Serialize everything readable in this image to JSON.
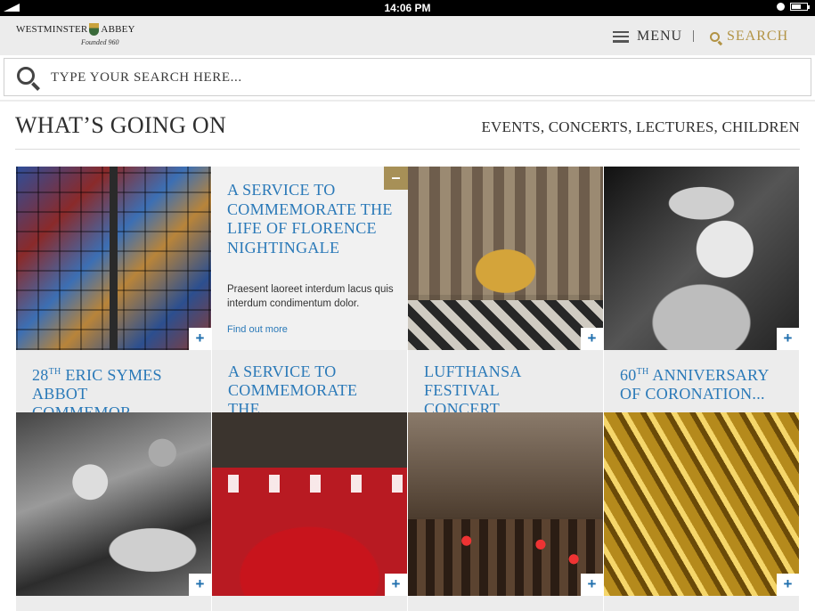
{
  "status_bar": {
    "time": "14:06 PM"
  },
  "header": {
    "logo_left": "WESTMINSTER",
    "logo_right": "ABBEY",
    "logo_founded": "Founded 960",
    "menu_label": "MENU",
    "search_label": "SEARCH"
  },
  "search": {
    "placeholder": "TYPE YOUR SEARCH HERE..."
  },
  "section": {
    "title": "WHAT’S GOING ON",
    "categories": "EVENTS, CONCERTS, LECTURES, CHILDREN"
  },
  "expanded_tile": {
    "title": "A SERVICE TO COMMEMORATE THE LIFE OF FLORENCE NIGHTINGALE",
    "body": "Praesent laoreet interdum lacus quis interdum condimentum dolor.",
    "link": "Find out more",
    "collapse_symbol": "–"
  },
  "tile_plus_symbol": "+",
  "captions": {
    "c1_num": "28",
    "c1_sup": "TH",
    "c1_line1_rest": " ERIC SYMES",
    "c1_line2": "ABBOT COMMEMOR...",
    "c2_line1": "A SERVICE TO",
    "c2_line2": "COMMEMORATE THE...",
    "c3_line1": "LUFTHANSA FESTIVAL",
    "c3_line2": "CONCERT",
    "c4_num": "60",
    "c4_sup": "TH",
    "c4_line1_rest": " ANNIVERSARY",
    "c4_line2": "OF CORONATION..."
  },
  "images": [
    "stained-glass-window",
    "choir-in-nave",
    "queen-portrait-bw",
    "coronation-crowd-bw",
    "choristers-red-robes",
    "quire-candles",
    "organ-pipes-gold"
  ],
  "colors": {
    "accent_blue": "#2a79b8",
    "gold": "#b29344",
    "minus_bg": "#a79057",
    "header_bg": "#ececec"
  }
}
